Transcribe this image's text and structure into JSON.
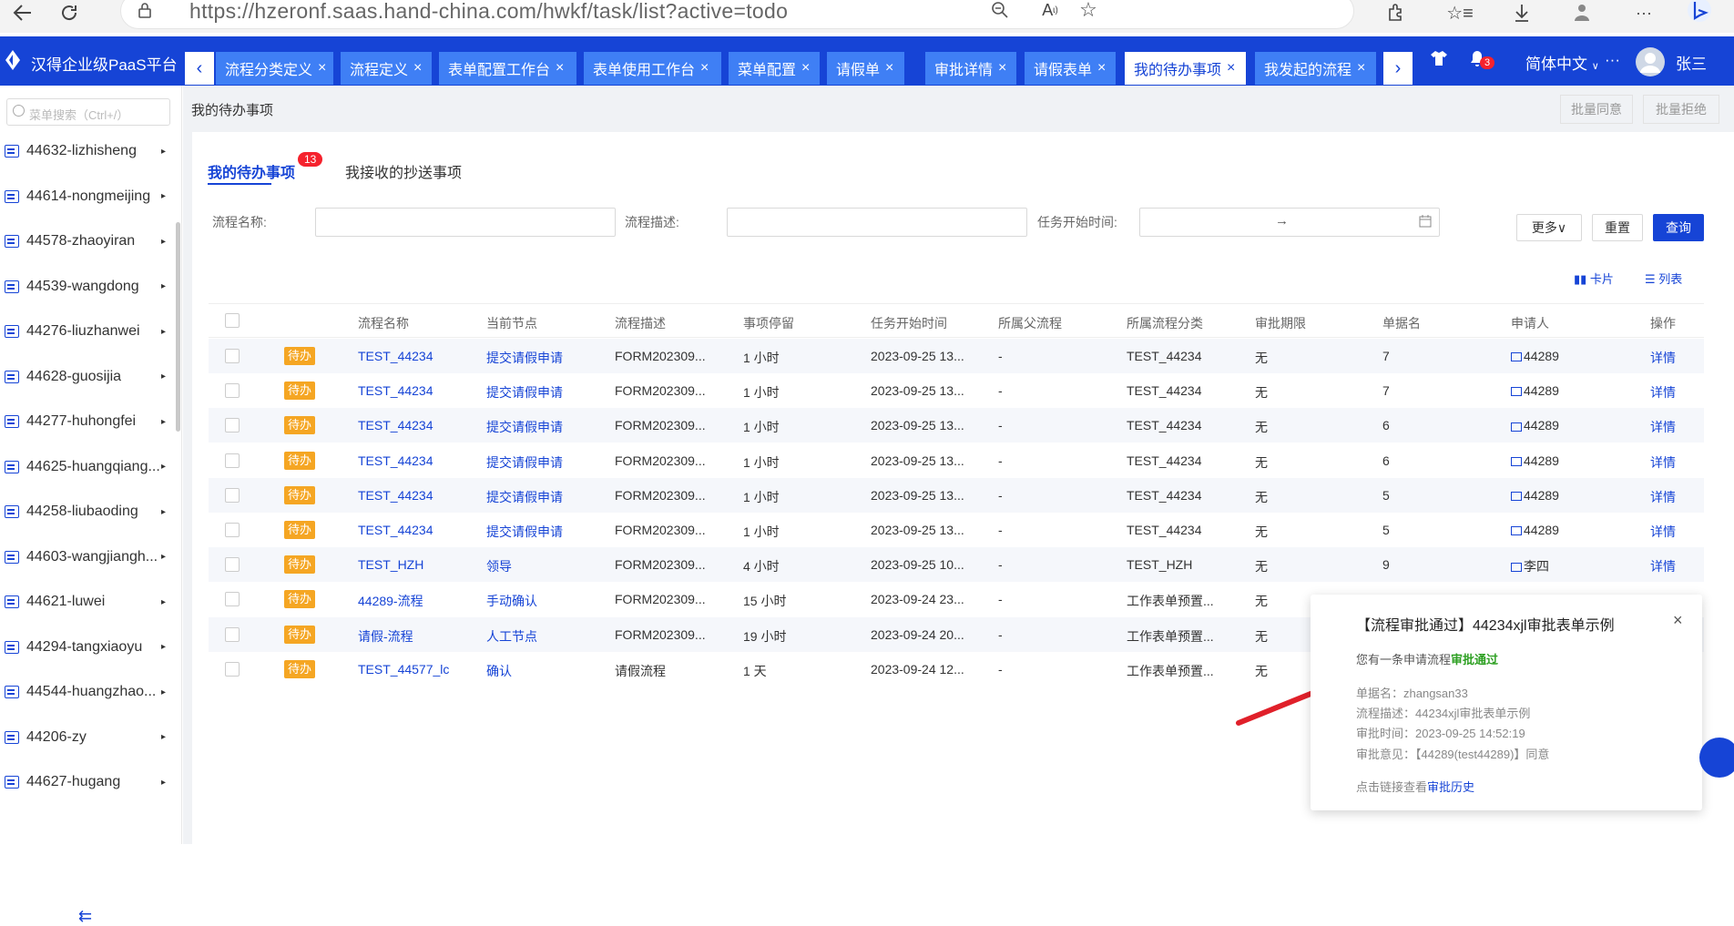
{
  "browser": {
    "url": "https://hzeronf.saas.hand-china.com/hwkf/task/list?active=todo",
    "icons": [
      "back-icon",
      "refresh-icon",
      "lock-icon",
      "zoom-icon",
      "read-aloud-icon",
      "favorite-icon",
      "extensions-icon",
      "favorites-list-icon",
      "download-icon",
      "profile-icon",
      "more-icon",
      "bing-icon"
    ]
  },
  "app": {
    "brand": "汉得企业级PaaS平台",
    "tabs": [
      {
        "label": "流程分类定义",
        "close": "×"
      },
      {
        "label": "流程定义",
        "close": "×"
      },
      {
        "label": "表单配置工作台",
        "close": "×"
      },
      {
        "label": "表单使用工作台",
        "close": "×"
      },
      {
        "label": "菜单配置",
        "close": "×"
      },
      {
        "label": "请假单",
        "close": "×"
      },
      {
        "label": "审批详情",
        "close": "×"
      },
      {
        "label": "请假表单",
        "close": "×"
      },
      {
        "label": "我的待办事项",
        "close": "×"
      },
      {
        "label": "我发起的流程",
        "close": "×"
      }
    ],
    "active_tab": "我的待办事项",
    "notification_count": "3",
    "language": "简体中文",
    "more": "···",
    "user": "张三"
  },
  "sidebar": {
    "search_placeholder": "菜单搜索（Ctrl+/）",
    "items": [
      {
        "label": "44632-lizhisheng"
      },
      {
        "label": "44614-nongmeijing"
      },
      {
        "label": "44578-zhaoyiran"
      },
      {
        "label": "44539-wangdong"
      },
      {
        "label": "44276-liuzhanwei"
      },
      {
        "label": "44628-guosijia"
      },
      {
        "label": "44277-huhongfei"
      },
      {
        "label": "44625-huangqiang..."
      },
      {
        "label": "44258-liubaoding"
      },
      {
        "label": "44603-wangjiangh..."
      },
      {
        "label": "44621-luwei"
      },
      {
        "label": "44294-tangxiaoyu"
      },
      {
        "label": "44544-huangzhao..."
      },
      {
        "label": "44206-zy"
      },
      {
        "label": "44627-hugang"
      }
    ]
  },
  "page": {
    "breadcrumb": "我的待办事项",
    "batch_approve": "批量同意",
    "batch_reject": "批量拒绝",
    "subtab_todo": "我的待办事项",
    "todo_count": "13",
    "subtab_cc": "我接收的抄送事项",
    "filters": {
      "name_label": "流程名称:",
      "desc_label": "流程描述:",
      "time_label": "任务开始时间:",
      "range_sep": "→"
    },
    "more_btn": "更多∨",
    "reset_btn": "重置",
    "query_btn": "查询",
    "view_card": "卡片",
    "view_list": "列表"
  },
  "table": {
    "columns": [
      "流程名称",
      "当前节点",
      "流程描述",
      "事项停留",
      "任务开始时间",
      "所属父流程",
      "所属流程分类",
      "审批期限",
      "单据名",
      "申请人",
      "操作"
    ],
    "status_tag": "待办",
    "rows": [
      [
        "TEST_44234",
        "提交请假申请",
        "FORM202309...",
        "1 小时",
        "2023-09-25 13...",
        "-",
        "TEST_44234",
        "无",
        "7",
        "44289",
        "详情"
      ],
      [
        "TEST_44234",
        "提交请假申请",
        "FORM202309...",
        "1 小时",
        "2023-09-25 13...",
        "-",
        "TEST_44234",
        "无",
        "7",
        "44289",
        "详情"
      ],
      [
        "TEST_44234",
        "提交请假申请",
        "FORM202309...",
        "1 小时",
        "2023-09-25 13...",
        "-",
        "TEST_44234",
        "无",
        "6",
        "44289",
        "详情"
      ],
      [
        "TEST_44234",
        "提交请假申请",
        "FORM202309...",
        "1 小时",
        "2023-09-25 13...",
        "-",
        "TEST_44234",
        "无",
        "6",
        "44289",
        "详情"
      ],
      [
        "TEST_44234",
        "提交请假申请",
        "FORM202309...",
        "1 小时",
        "2023-09-25 13...",
        "-",
        "TEST_44234",
        "无",
        "5",
        "44289",
        "详情"
      ],
      [
        "TEST_44234",
        "提交请假申请",
        "FORM202309...",
        "1 小时",
        "2023-09-25 13...",
        "-",
        "TEST_44234",
        "无",
        "5",
        "44289",
        "详情"
      ],
      [
        "TEST_HZH",
        "领导",
        "FORM202309...",
        "4 小时",
        "2023-09-25 10...",
        "-",
        "TEST_HZH",
        "无",
        "9",
        "李四",
        "详情"
      ],
      [
        "44289-流程",
        "手动确认",
        "FORM202309...",
        "15 小时",
        "2023-09-24 23...",
        "-",
        "工作表单预置...",
        "无",
        "",
        "",
        ""
      ],
      [
        "请假-流程",
        "人工节点",
        "FORM202309...",
        "19 小时",
        "2023-09-24 20...",
        "-",
        "工作表单预置...",
        "无",
        "",
        "",
        ""
      ],
      [
        "TEST_44577_lc",
        "确认",
        "请假流程",
        "1 天",
        "2023-09-24 12...",
        "-",
        "工作表单预置...",
        "无",
        "",
        "",
        ""
      ]
    ]
  },
  "popup": {
    "title": "【流程审批通过】44234xjl审批表单示例",
    "msg_prefix": "您有一条申请流程",
    "msg_status": "审批通过",
    "doc_name": "单据名：zhangsan33",
    "desc": "流程描述：44234xjl审批表单示例",
    "time": "审批时间：2023-09-25 14:52:19",
    "opinion": "审批意见：【44289(test44289)】同意",
    "link_prefix": "点击链接查看",
    "link_text": "审批历史",
    "close": "×"
  },
  "colors": {
    "primary": "#1644d6",
    "tab": "#3f7ff5",
    "tag": "#f5a623",
    "pass": "#2ea023",
    "badge": "#f5222d",
    "arrow": "#e0202a"
  }
}
